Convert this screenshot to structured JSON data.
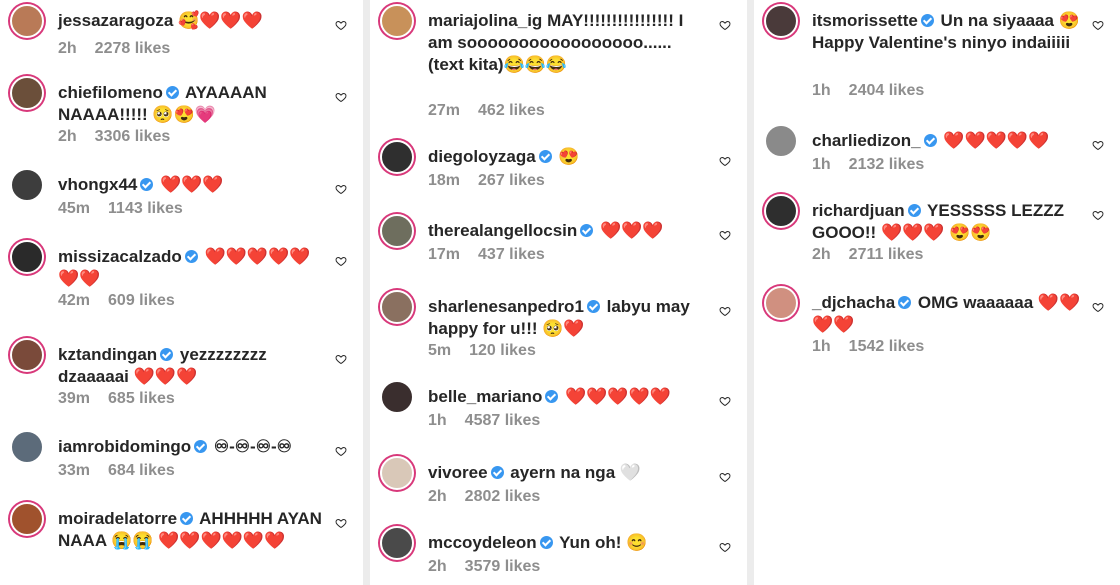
{
  "colors": {
    "accent": "#3897f0",
    "ring": "#d8387a",
    "muted": "#8e8e8e",
    "text": "#262626"
  },
  "columns": [
    [
      {
        "user": "jessazaragoza",
        "verified": false,
        "text": "🥰❤️❤️❤️",
        "time": "2h",
        "likes": "2278 likes"
      },
      {
        "user": "chiefilomeno",
        "verified": true,
        "text": "AYAAAAN NAAAA!!!!! 🥺😍💗",
        "time": "2h",
        "likes": "3306 likes"
      },
      {
        "user": "vhongx44",
        "verified": true,
        "text": "❤️❤️❤️",
        "time": "45m",
        "likes": "1143 likes"
      },
      {
        "user": "missizacalzado",
        "verified": true,
        "text": "❤️❤️❤️❤️❤️❤️❤️",
        "time": "42m",
        "likes": "609 likes"
      },
      {
        "user": "kztandingan",
        "verified": true,
        "text": "yezzzzzzzz dzaaaaai ❤️❤️❤️",
        "time": "39m",
        "likes": "685 likes"
      },
      {
        "user": "iamrobidomingo",
        "verified": true,
        "text": "♾-♾-♾-♾",
        "time": "33m",
        "likes": "684 likes"
      },
      {
        "user": "moiradelatorre",
        "verified": true,
        "text": "AHHHHH AYAN NAAA 😭😭 ❤️❤️❤️❤️❤️❤️",
        "time": "",
        "likes": ""
      }
    ],
    [
      {
        "user": "mariajolina_ig",
        "verified": false,
        "text": "MAY!!!!!!!!!!!!!!!! I am sooooooooooooooooo...... (text kita)😂😂😂",
        "time": "27m",
        "likes": "462 likes"
      },
      {
        "user": "diegoloyzaga",
        "verified": true,
        "text": "😍",
        "time": "18m",
        "likes": "267 likes"
      },
      {
        "user": "therealangellocsin",
        "verified": true,
        "text": "❤️❤️❤️",
        "time": "17m",
        "likes": "437 likes"
      },
      {
        "user": "sharlenesanpedro1",
        "verified": true,
        "text": "labyu may happy for u!!! 🥺❤️",
        "time": "5m",
        "likes": "120 likes"
      },
      {
        "user": "belle_mariano",
        "verified": true,
        "text": "❤️❤️❤️❤️❤️",
        "time": "1h",
        "likes": "4587 likes"
      },
      {
        "user": "vivoree",
        "verified": true,
        "text": "ayern na nga 🤍",
        "time": "2h",
        "likes": "2802 likes"
      },
      {
        "user": "mccoydeleon",
        "verified": true,
        "text": "Yun oh! 😊",
        "time": "2h",
        "likes": "3579 likes"
      }
    ],
    [
      {
        "user": "itsmorissette",
        "verified": true,
        "text": "Un na siyaaaa 😍 Happy Valentine's ninyo indaiiiii",
        "time": "1h",
        "likes": "2404 likes"
      },
      {
        "user": "charliedizon_",
        "verified": true,
        "text": "❤️❤️❤️❤️❤️",
        "time": "1h",
        "likes": "2132 likes"
      },
      {
        "user": "richardjuan",
        "verified": true,
        "text": "YESSSSS LEZZZ GOOO!! ❤️❤️❤️ 😍😍",
        "time": "2h",
        "likes": "2711 likes"
      },
      {
        "user": "_djchacha",
        "verified": true,
        "text": "OMG waaaaaa ❤️❤️❤️❤️",
        "time": "1h",
        "likes": "1542 likes"
      }
    ]
  ],
  "icons": {
    "heart": "heart-outline-icon",
    "verified": "verified-badge-icon"
  }
}
